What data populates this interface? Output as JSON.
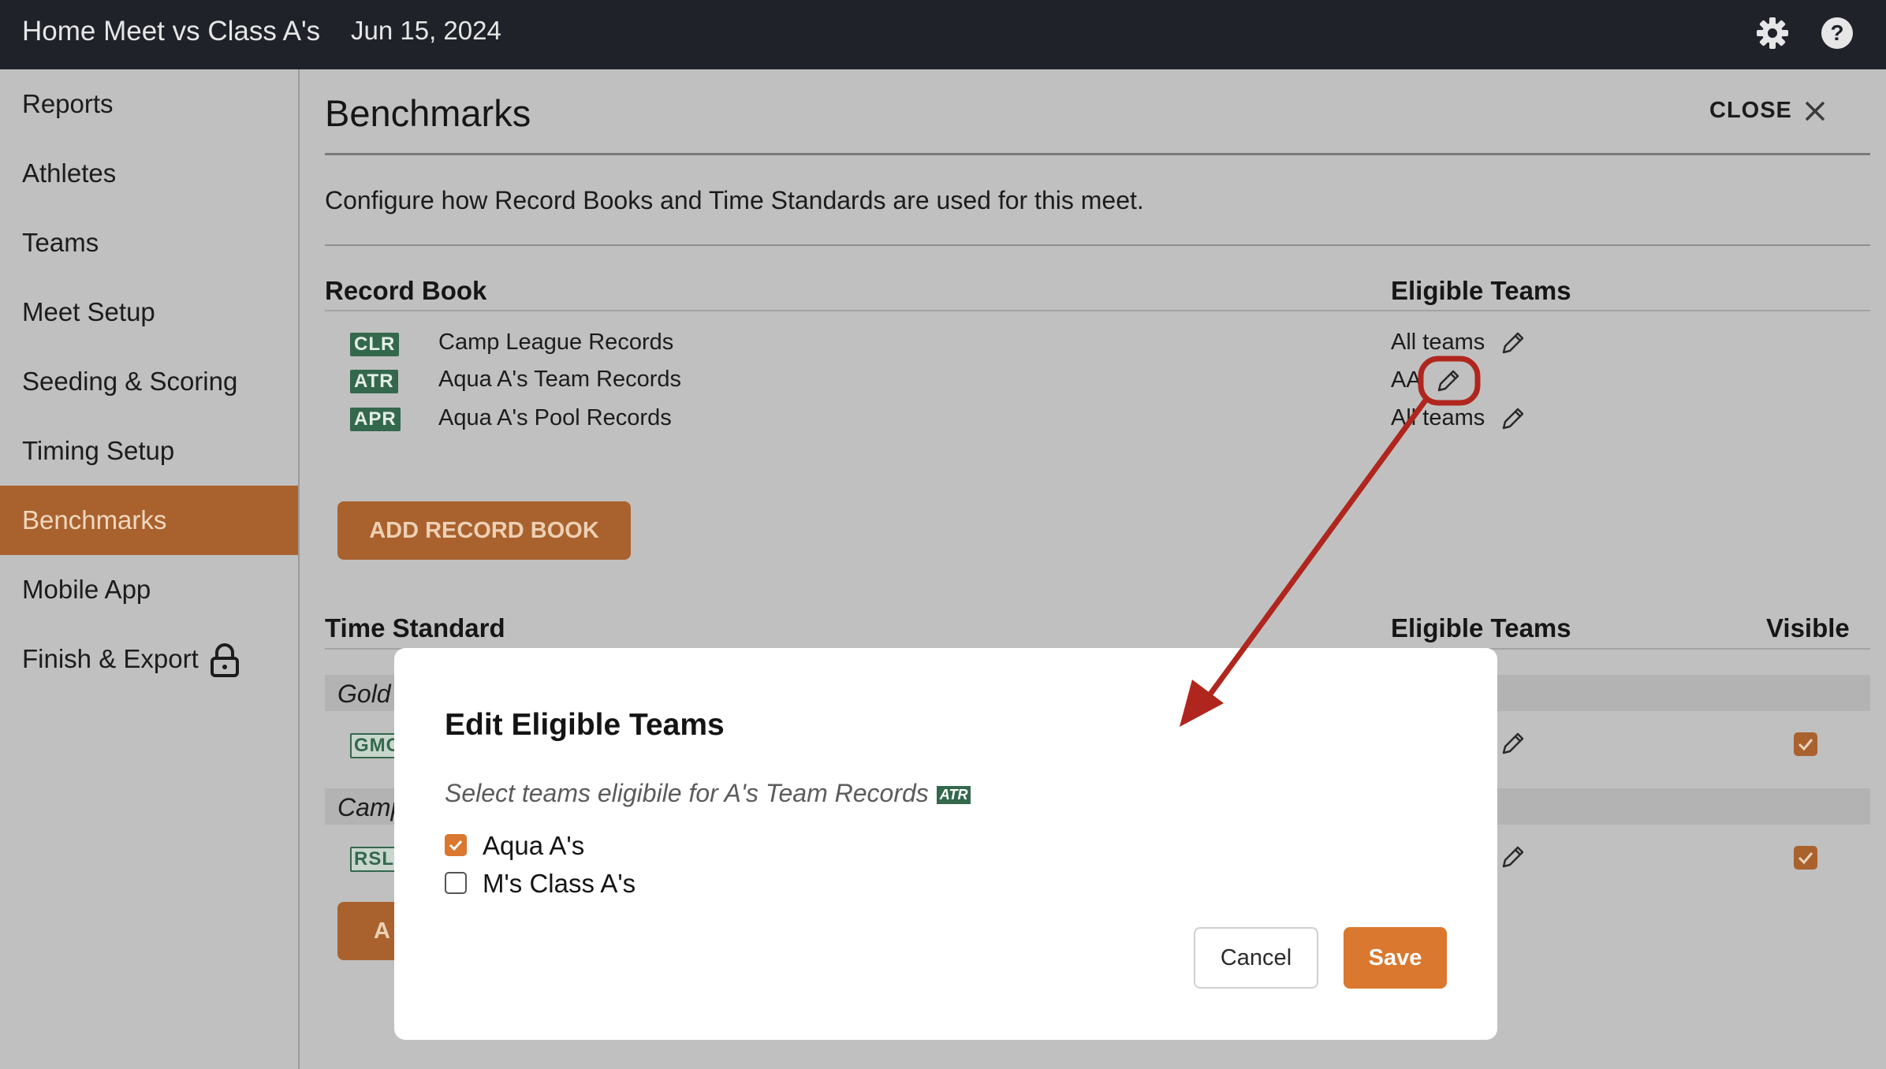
{
  "header": {
    "title": "Home Meet vs Class A's",
    "date": "Jun 15, 2024"
  },
  "sidebar": {
    "items": [
      {
        "label": "Reports"
      },
      {
        "label": "Athletes"
      },
      {
        "label": "Teams"
      },
      {
        "label": "Meet Setup"
      },
      {
        "label": "Seeding & Scoring"
      },
      {
        "label": "Timing Setup"
      },
      {
        "label": "Benchmarks",
        "active": true
      },
      {
        "label": "Mobile App"
      },
      {
        "label": "Finish & Export",
        "icon": "lock-icon"
      }
    ]
  },
  "main": {
    "title": "Benchmarks",
    "close_label": "CLOSE",
    "description": "Configure how Record Books and Time Standards are used for this meet.",
    "record_book": {
      "heading": "Record Book",
      "eligible_heading": "Eligible Teams",
      "rows": [
        {
          "badge": "CLR",
          "name": "Camp League Records",
          "eligible": "All teams"
        },
        {
          "badge": "ATR",
          "name": "Aqua A's Team Records",
          "eligible": "AA"
        },
        {
          "badge": "APR",
          "name": "Aqua A's Pool Records",
          "eligible": "All teams"
        }
      ],
      "add_label": "ADD RECORD BOOK"
    },
    "time_standard": {
      "heading": "Time Standard",
      "eligible_heading": "Eligible Teams",
      "visible_heading": "Visible",
      "groups": [
        {
          "label": "Gold",
          "badge": "GMC",
          "visible": true
        },
        {
          "label": "Camp",
          "badge": "RSL",
          "visible": true
        }
      ],
      "add_label_partial": "A"
    }
  },
  "modal": {
    "title": "Edit Eligible Teams",
    "subtitle": "Select teams eligibile for A's Team Records",
    "subtitle_badge": "ATR",
    "options": [
      {
        "label": "Aqua A's",
        "checked": true
      },
      {
        "label": "M's Class A's",
        "checked": false
      }
    ],
    "cancel_label": "Cancel",
    "save_label": "Save"
  },
  "colors": {
    "accent": "#d9782e",
    "accent_dimmed": "#a9622e",
    "badge_green": "#34684d",
    "topbar": "#1f2329",
    "annotation_red": "#b0261e"
  }
}
